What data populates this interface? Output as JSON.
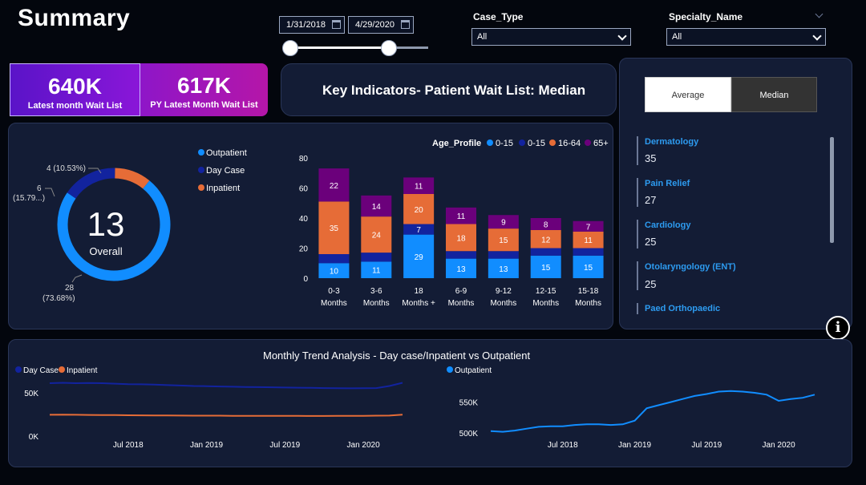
{
  "page": {
    "title": "Summary"
  },
  "date_filter": {
    "start": "1/31/2018",
    "end": "4/29/2020"
  },
  "filters": {
    "case_type": {
      "label": "Case_Type",
      "value": "All"
    },
    "specialty": {
      "label": "Specialty_Name",
      "value": "All"
    }
  },
  "kpis": [
    {
      "value": "640K",
      "label": "Latest month Wait List"
    },
    {
      "value": "617K",
      "label": "PY Latest Month Wait List"
    }
  ],
  "key_indicators": {
    "title": "Key Indicators- Patient Wait List: Median"
  },
  "toggle": {
    "average": "Average",
    "median": "Median"
  },
  "specialties": [
    {
      "name": "Dermatology",
      "value": "35"
    },
    {
      "name": "Pain Relief",
      "value": "27"
    },
    {
      "name": "Cardiology",
      "value": "25"
    },
    {
      "name": "Otolaryngology (ENT)",
      "value": "25"
    },
    {
      "name": "Paed Orthopaedic",
      "value": ""
    }
  ],
  "colors": {
    "outpatient": "#118dff",
    "daycase": "#12239e",
    "inpatient": "#e66c37",
    "age_65": "#6b007b",
    "panel": "#131c35"
  },
  "donut": {
    "center_value": "13",
    "center_label": "Overall",
    "legend": [
      "Outpatient",
      "Day Case",
      "Inpatient"
    ],
    "slices": [
      {
        "name": "Outpatient",
        "value": 28,
        "label1": "28",
        "label2": "(73.68%)"
      },
      {
        "name": "Day Case",
        "value": 6,
        "label1": "6",
        "label2": "(15.79...)"
      },
      {
        "name": "Inpatient",
        "value": 4,
        "label1": "4 (10.53%)",
        "label2": ""
      }
    ]
  },
  "chart_data": [
    {
      "type": "bar",
      "stacked": true,
      "legend_title": "Age_Profile",
      "legend": [
        "0-15",
        "0-15",
        "16-64",
        "65+"
      ],
      "categories": [
        [
          "0-3",
          "Months"
        ],
        [
          "3-6",
          "Months"
        ],
        [
          "18",
          "Months +"
        ],
        [
          "6-9",
          "Months"
        ],
        [
          "9-12",
          "Months"
        ],
        [
          "12-15",
          "Months"
        ],
        [
          "15-18",
          "Months"
        ]
      ],
      "series": [
        {
          "name": "0-15",
          "color": "#118dff",
          "values": [
            10,
            11,
            29,
            13,
            13,
            15,
            15
          ]
        },
        {
          "name": "0-15",
          "color": "#12239e",
          "values": [
            6,
            6,
            7,
            5,
            5,
            5,
            5
          ]
        },
        {
          "name": "16-64",
          "color": "#e66c37",
          "values": [
            35,
            24,
            20,
            18,
            15,
            12,
            11
          ]
        },
        {
          "name": "65+",
          "color": "#6b007b",
          "values": [
            22,
            14,
            11,
            11,
            9,
            8,
            7
          ]
        }
      ],
      "data_labels": [
        [
          "10",
          "",
          "35",
          "22"
        ],
        [
          "11",
          "",
          "24",
          "14"
        ],
        [
          "29",
          "7",
          "20",
          "11"
        ],
        [
          "13",
          "",
          "18",
          "11"
        ],
        [
          "13",
          "",
          "15",
          "9"
        ],
        [
          "15",
          "",
          "12",
          "8"
        ],
        [
          "15",
          "",
          "11",
          "7"
        ]
      ],
      "y_ticks": [
        0,
        20,
        40,
        60,
        80
      ],
      "ylim": [
        0,
        80
      ]
    },
    {
      "type": "line",
      "title": "Monthly Trend Analysis - Day case/Inpatient vs Outpatient",
      "legend": [
        "Day Case",
        "Inpatient"
      ],
      "x_ticks": [
        "Jul 2018",
        "Jan 2019",
        "Jul 2019",
        "Jan 2020"
      ],
      "y_ticks": [
        "0K",
        "50K"
      ],
      "ylim": [
        0,
        70000
      ],
      "x": [
        "2018-01",
        "2018-02",
        "2018-03",
        "2018-04",
        "2018-05",
        "2018-06",
        "2018-07",
        "2018-08",
        "2018-09",
        "2018-10",
        "2018-11",
        "2018-12",
        "2019-01",
        "2019-02",
        "2019-03",
        "2019-04",
        "2019-05",
        "2019-06",
        "2019-07",
        "2019-08",
        "2019-09",
        "2019-10",
        "2019-11",
        "2019-12",
        "2020-01",
        "2020-02",
        "2020-03",
        "2020-04"
      ],
      "series": [
        {
          "name": "Day Case",
          "color": "#12239e",
          "values": [
            57000,
            57500,
            57000,
            57200,
            57000,
            56500,
            56000,
            55800,
            55500,
            55000,
            54500,
            54000,
            53800,
            53500,
            53200,
            53000,
            52800,
            52600,
            52400,
            52200,
            52000,
            51800,
            51700,
            51500,
            51600,
            51800,
            54000,
            57500
          ]
        },
        {
          "name": "Inpatient",
          "color": "#e66c37",
          "values": [
            23000,
            23200,
            23000,
            22800,
            22700,
            22600,
            22500,
            22400,
            22300,
            22200,
            22100,
            22000,
            22000,
            22000,
            21900,
            21900,
            21800,
            21800,
            21800,
            21800,
            21700,
            21700,
            21800,
            21800,
            21900,
            22000,
            22100,
            23200
          ]
        }
      ]
    },
    {
      "type": "line",
      "legend": [
        "Outpatient"
      ],
      "x_ticks": [
        "Jul 2018",
        "Jan 2019",
        "Jul 2019",
        "Jan 2020"
      ],
      "y_ticks": [
        "500K",
        "550K"
      ],
      "ylim": [
        495000,
        600000
      ],
      "x": [
        "2018-01",
        "2018-02",
        "2018-03",
        "2018-04",
        "2018-05",
        "2018-06",
        "2018-07",
        "2018-08",
        "2018-09",
        "2018-10",
        "2018-11",
        "2018-12",
        "2019-01",
        "2019-02",
        "2019-03",
        "2019-04",
        "2019-05",
        "2019-06",
        "2019-07",
        "2019-08",
        "2019-09",
        "2019-10",
        "2019-11",
        "2019-12",
        "2020-01",
        "2020-02",
        "2020-03",
        "2020-04"
      ],
      "series": [
        {
          "name": "Outpatient",
          "color": "#118dff",
          "values": [
            503000,
            502000,
            504000,
            507000,
            510000,
            511000,
            511000,
            513000,
            514000,
            514000,
            513000,
            514000,
            520000,
            540000,
            545000,
            550000,
            555000,
            560000,
            563000,
            567000,
            568000,
            567000,
            565000,
            562000,
            552000,
            555000,
            557000,
            562000
          ]
        }
      ]
    }
  ]
}
